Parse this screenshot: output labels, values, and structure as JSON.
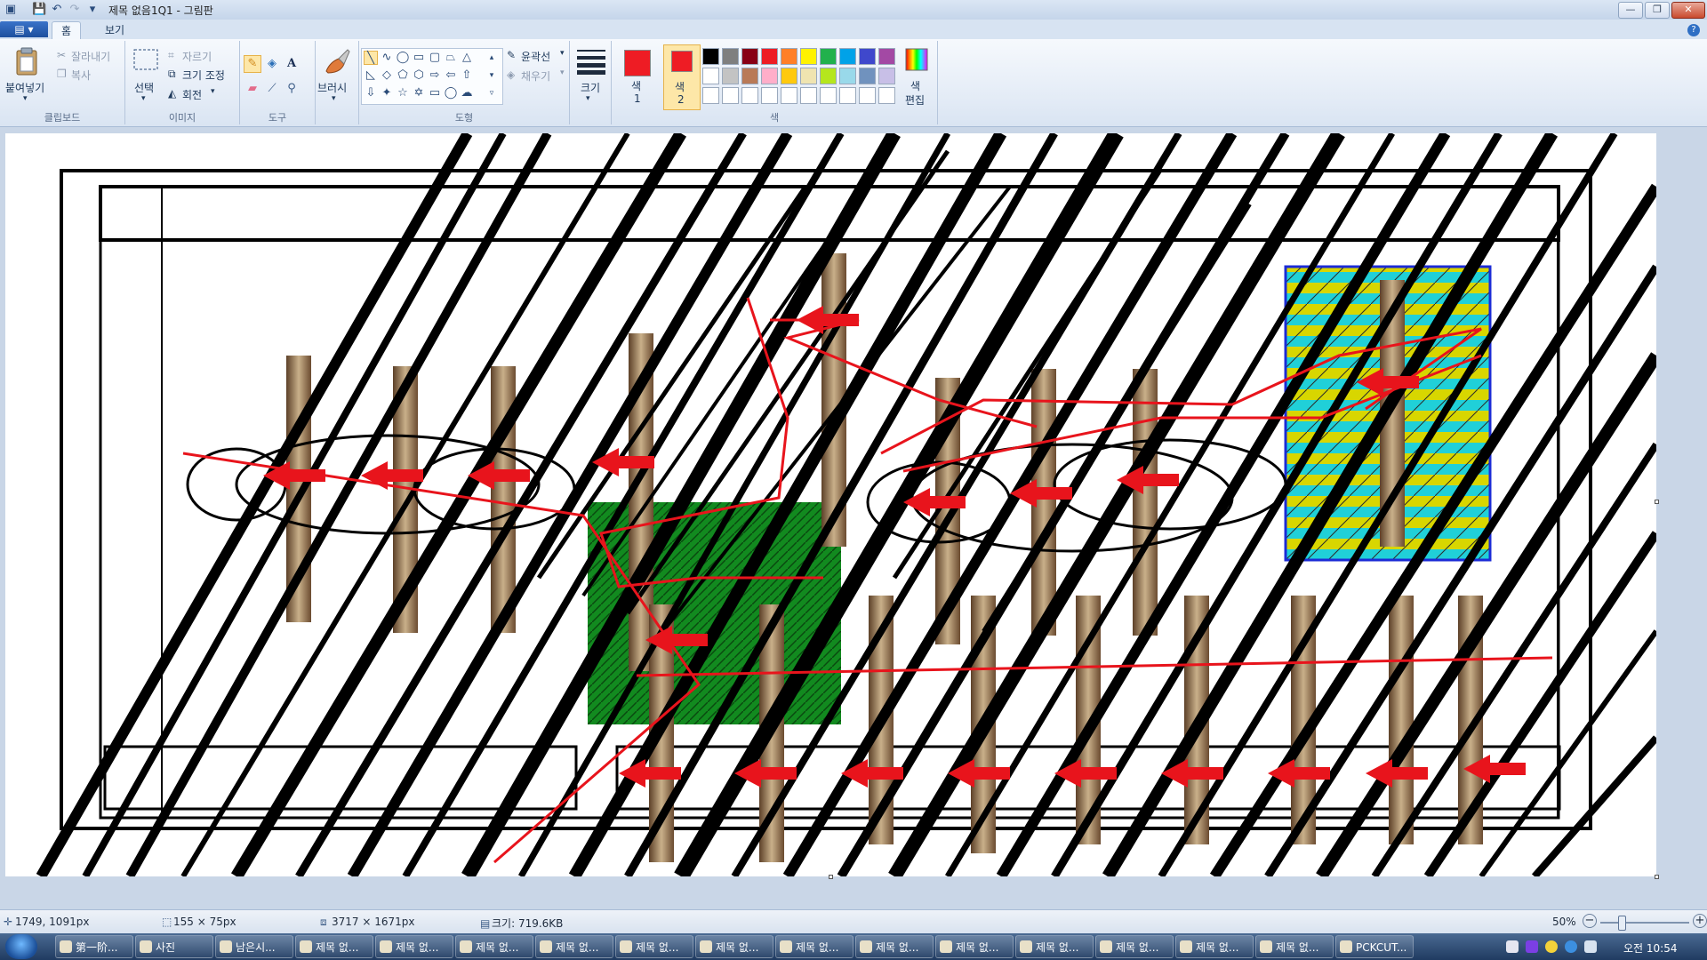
{
  "window": {
    "title": "제목 없음1Q1 - 그림판",
    "minimize": "—",
    "maximize": "❐",
    "close": "✕"
  },
  "quick_access": {
    "save": "💾",
    "undo": "↶",
    "redo": "↷",
    "more": "▾"
  },
  "tabs": {
    "file": "▤ ▾",
    "home": "홈",
    "view": "보기",
    "help": "?"
  },
  "ribbon": {
    "clipboard": {
      "group": "클립보드",
      "paste": "붙여넣기",
      "cut": "잘라내기",
      "copy": "복사"
    },
    "image": {
      "group": "이미지",
      "select": "선택",
      "crop": "자르기",
      "resize": "크기 조정",
      "rotate": "회전"
    },
    "tools": {
      "group": "도구"
    },
    "brushes": {
      "label": "브러시"
    },
    "shapes": {
      "group": "도형",
      "outline": "윤곽선",
      "fill": "채우기"
    },
    "size": {
      "label": "크기"
    },
    "colors": {
      "group": "색",
      "color1_label": "색\n1",
      "color1_a": "색",
      "color1_b": "1",
      "color2_a": "색",
      "color2_b": "2",
      "edit_a": "색",
      "edit_b": "편집",
      "color1": "#ee1c24",
      "color2": "#ee1c24",
      "palette_row1": [
        "#000000",
        "#7f7f7f",
        "#880015",
        "#ed1c24",
        "#ff7f27",
        "#fff200",
        "#22b14c",
        "#00a2e8",
        "#3f48cc",
        "#a349a4"
      ],
      "palette_row2": [
        "#ffffff",
        "#c3c3c3",
        "#b97a57",
        "#ffaec9",
        "#ffc90e",
        "#efe4b0",
        "#b5e61d",
        "#99d9ea",
        "#7092be",
        "#c8bfe7"
      ]
    }
  },
  "status": {
    "cursor": "1749, 1091px",
    "selection": "155 × 75px",
    "image_size": "3717 × 1671px",
    "file_size": "크기: 719.6KB",
    "zoom": "50%"
  },
  "taskbar": {
    "items": [
      "第一阶...",
      "사진",
      "남은시...",
      "제목 없...",
      "제목 없...",
      "제목 없...",
      "제목 없...",
      "제목 없...",
      "제목 없...",
      "제목 없...",
      "제목 없...",
      "제목 없...",
      "제목 없...",
      "제목 없...",
      "제목 없...",
      "제목 없...",
      "PCKCUT..."
    ],
    "clock": "오전 10:54"
  }
}
